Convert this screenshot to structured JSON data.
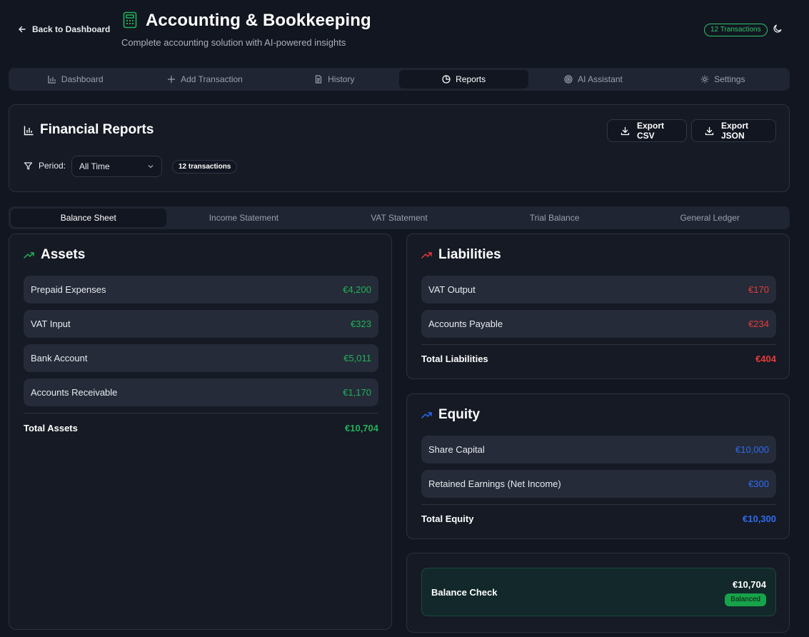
{
  "header": {
    "back_label": "Back to Dashboard",
    "title": "Accounting & Bookkeeping",
    "subtitle": "Complete accounting solution with AI-powered insights",
    "transactions_badge": "12 Transactions"
  },
  "nav": {
    "items": [
      {
        "label": "Dashboard",
        "icon": "bar-chart-icon"
      },
      {
        "label": "Add Transaction",
        "icon": "plus-icon"
      },
      {
        "label": "History",
        "icon": "document-icon"
      },
      {
        "label": "Reports",
        "icon": "pie-chart-icon"
      },
      {
        "label": "AI Assistant",
        "icon": "target-icon"
      },
      {
        "label": "Settings",
        "icon": "gear-icon"
      }
    ],
    "active": "Reports"
  },
  "reports": {
    "title": "Financial Reports",
    "export_csv": "Export CSV",
    "export_json": "Export JSON",
    "period_label": "Period:",
    "period_value": "All Time",
    "transactions_count": "12 transactions"
  },
  "report_tabs": {
    "items": [
      "Balance Sheet",
      "Income Statement",
      "VAT Statement",
      "Trial Balance",
      "General Ledger"
    ],
    "active": "Balance Sheet"
  },
  "assets": {
    "title": "Assets",
    "items": [
      {
        "label": "Prepaid Expenses",
        "value": "€4,200"
      },
      {
        "label": "VAT Input",
        "value": "€323"
      },
      {
        "label": "Bank Account",
        "value": "€5,011"
      },
      {
        "label": "Accounts Receivable",
        "value": "€1,170"
      }
    ],
    "total_label": "Total Assets",
    "total_value": "€10,704"
  },
  "liabilities": {
    "title": "Liabilities",
    "items": [
      {
        "label": "VAT Output",
        "value": "€170"
      },
      {
        "label": "Accounts Payable",
        "value": "€234"
      }
    ],
    "total_label": "Total Liabilities",
    "total_value": "€404"
  },
  "equity": {
    "title": "Equity",
    "items": [
      {
        "label": "Share Capital",
        "value": "€10,000"
      },
      {
        "label": "Retained Earnings (Net Income)",
        "value": "€300"
      }
    ],
    "total_label": "Total Equity",
    "total_value": "€10,300"
  },
  "balance_check": {
    "label": "Balance Check",
    "amount": "€10,704",
    "status": "Balanced"
  },
  "colors": {
    "assets": "#22b25a",
    "liabilities": "#e83b3b",
    "equity": "#2f6bf0",
    "accent_green": "#2ec26a"
  }
}
